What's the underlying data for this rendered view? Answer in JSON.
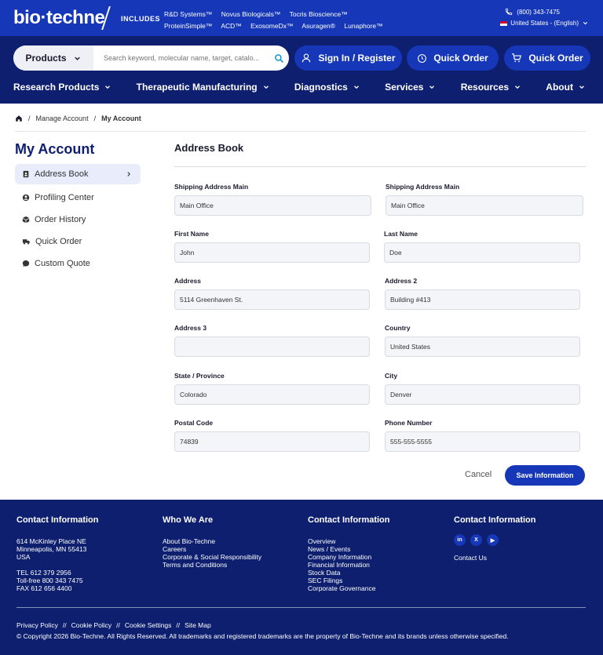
{
  "topbar": {
    "logo": "bio·techne",
    "includes": "INCLUDES",
    "brands_row1": [
      "R&D Systems™",
      "Novus Biologicals™",
      "Tocris Bioscience™"
    ],
    "brands_row2": [
      "ProteinSimple™",
      "ACD™",
      "ExosomeDx™",
      "Asuragen®",
      "Lunaphore™"
    ],
    "phone": "(800) 343-7475",
    "locale": "United States - (English)"
  },
  "header": {
    "search_category": "Products",
    "search_placeholder": "Search keyword, molecular name, target, catalo...",
    "sign_in": "Sign In / Register",
    "quick_order_1": "Quick Order",
    "quick_order_2": "Quick Order"
  },
  "nav": [
    "Research Products",
    "Therapeutic Manufacturing",
    "Diagnostics",
    "Services",
    "Resources",
    "About"
  ],
  "breadcrumb": {
    "manage": "Manage Account",
    "current": "My Account"
  },
  "sidebar": {
    "title": "My Account",
    "items": [
      {
        "label": "Address Book",
        "icon": "address-book-icon"
      },
      {
        "label": "Profiling Center",
        "icon": "user-icon"
      },
      {
        "label": "Order History",
        "icon": "box-icon"
      },
      {
        "label": "Quick Order",
        "icon": "truck-icon"
      },
      {
        "label": "Custom Quote",
        "icon": "chat-icon"
      }
    ]
  },
  "form": {
    "title": "Address Book",
    "fields": [
      {
        "label": "Shipping Address Main",
        "value": "Main Office"
      },
      {
        "label": "Shipping Address Main",
        "value": "Main Office"
      },
      {
        "label": "First Name",
        "value": "John"
      },
      {
        "label": "Last Name",
        "value": "Doe"
      },
      {
        "label": "Address",
        "value": "5114 Greenhaven St."
      },
      {
        "label": "Address 2",
        "value": "Building #413"
      },
      {
        "label": "Address 3",
        "value": ""
      },
      {
        "label": "Country",
        "value": "United States"
      },
      {
        "label": "State / Province",
        "value": "Colorado"
      },
      {
        "label": "City",
        "value": "Denver"
      },
      {
        "label": "Postal Code",
        "value": "74839"
      },
      {
        "label": "Phone Number",
        "value": "555-555-5555"
      }
    ],
    "cancel": "Cancel",
    "save": "Save Information"
  },
  "footer": {
    "col1": {
      "title": "Contact Information",
      "addr1": "614 McKinley Place NE",
      "addr2": "Minneapolis, MN 55413",
      "addr3": "USA",
      "tel": "TEL 612 379 2956",
      "tollfree": "Toll-free 800 343 7475",
      "fax": "FAX 612 656 4400"
    },
    "col2": {
      "title": "Who We Are",
      "links": [
        "About Bio-Techne",
        "Careers",
        "Corporate & Social Responsibility",
        "Terms and Conditions"
      ]
    },
    "col3": {
      "title": "Contact Information",
      "links": [
        "Overview",
        "News / Events",
        "Company Information",
        "Financial Information",
        "Stock Data",
        "SEC Filings",
        "Corporate Governance"
      ]
    },
    "col4": {
      "title": "Contact Information",
      "social": [
        "in",
        "X",
        "▶"
      ],
      "contact_us": "Contact Us"
    },
    "bottom_links": [
      "Privacy Policy",
      "Cookie Policy",
      "Cookie Settings",
      "Site Map"
    ],
    "separator": "//",
    "copyright": "© Copyright 2026 Bio-Techne. All Rights Reserved. All trademarks and registered trademarks are the property of Bio-Techne and its brands unless otherwise specified."
  },
  "colors": {
    "brand_blue": "#1537b8",
    "navy": "#0d1f6e"
  }
}
